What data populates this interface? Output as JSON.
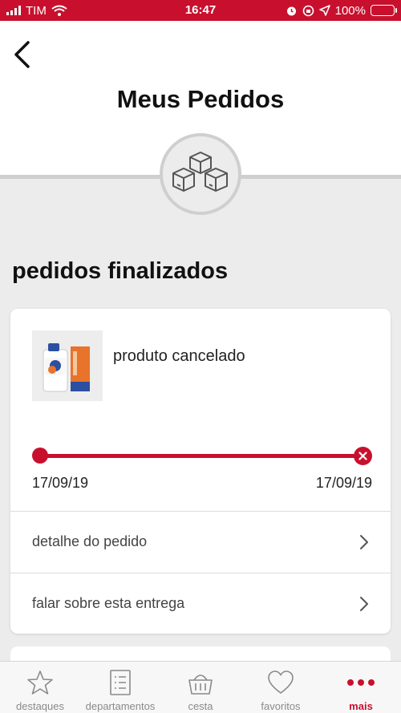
{
  "status_bar": {
    "carrier": "TIM",
    "time": "16:47",
    "battery": "100%"
  },
  "header": {
    "title": "Meus Pedidos",
    "icon": "boxes-icon"
  },
  "section": {
    "title": "pedidos finalizados"
  },
  "order": {
    "product_image": "detergent-bottle-image",
    "status": "produto cancelado",
    "date_start": "17/09/19",
    "date_end": "17/09/19",
    "actions": [
      {
        "label": "detalhe do pedido"
      },
      {
        "label": "falar sobre esta entrega"
      }
    ]
  },
  "tab_bar": {
    "tabs": [
      {
        "label": "destaques",
        "icon": "star-icon"
      },
      {
        "label": "departamentos",
        "icon": "list-icon"
      },
      {
        "label": "cesta",
        "icon": "basket-icon"
      },
      {
        "label": "favoritos",
        "icon": "heart-icon"
      },
      {
        "label": "mais",
        "icon": "more-icon",
        "active": true
      }
    ]
  },
  "colors": {
    "accent": "#c8102e",
    "background": "#ececec"
  }
}
